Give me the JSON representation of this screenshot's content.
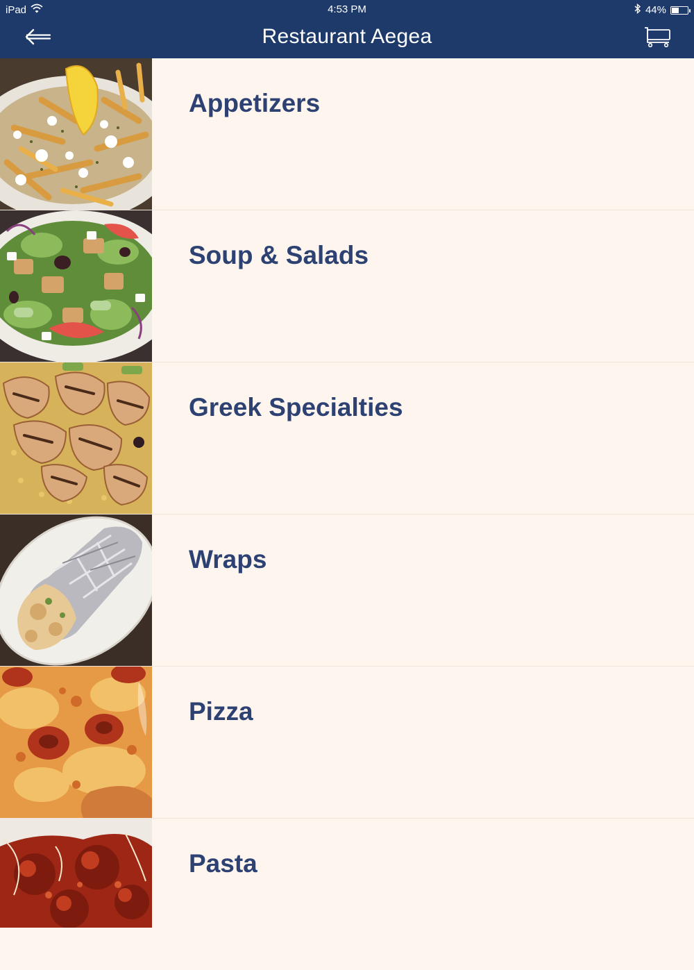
{
  "status_bar": {
    "device": "iPad",
    "time": "4:53 PM",
    "battery": "44%",
    "battery_level": 0.44
  },
  "nav": {
    "title": "Restaurant Aegea",
    "back_icon": "back-arrow-icon",
    "cart_icon": "shopping-cart-icon"
  },
  "categories": [
    {
      "label": "Appetizers",
      "image": "fries-with-feta-and-lemon"
    },
    {
      "label": "Soup & Salads",
      "image": "greek-salad-with-chicken"
    },
    {
      "label": "Greek Specialties",
      "image": "grilled-chicken-over-rice"
    },
    {
      "label": "Wraps",
      "image": "foil-wrapped-gyro"
    },
    {
      "label": "Pizza",
      "image": "pepperoni-pizza"
    },
    {
      "label": "Pasta",
      "image": "spaghetti-and-meatballs"
    }
  ],
  "colors": {
    "nav_background": "#1e3a6a",
    "list_background": "#fdf5ee",
    "label_text": "#2d4273"
  }
}
